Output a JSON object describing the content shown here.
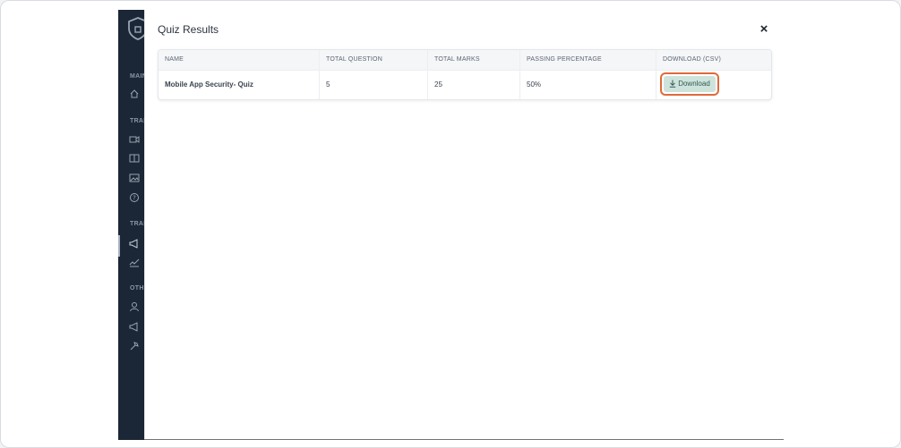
{
  "modal": {
    "title": "Quiz Results",
    "close_label": "×"
  },
  "table": {
    "headers": [
      "NAME",
      "TOTAL QUESTION",
      "TOTAL MARKS",
      "PASSING PERCENTAGE",
      "DOWNLOAD (CSV)"
    ],
    "rows": [
      {
        "name": "Mobile App Security- Quiz",
        "total_question": "5",
        "total_marks": "25",
        "passing_percentage": "50%",
        "download_label": "Download"
      }
    ]
  },
  "sidebar": {
    "sections": [
      "MAIN",
      "TRAI",
      "TRAI",
      "OTHE"
    ],
    "icons": [
      "home-icon",
      "video-icon",
      "book-icon",
      "image-icon",
      "help-icon",
      "megaphone-icon",
      "chart-icon",
      "user-icon",
      "megaphone-icon",
      "tool-icon"
    ]
  },
  "colors": {
    "sidebar_bg": "#1b2636",
    "download_bg": "#cfe3dd",
    "highlight": "#e06a3c"
  }
}
